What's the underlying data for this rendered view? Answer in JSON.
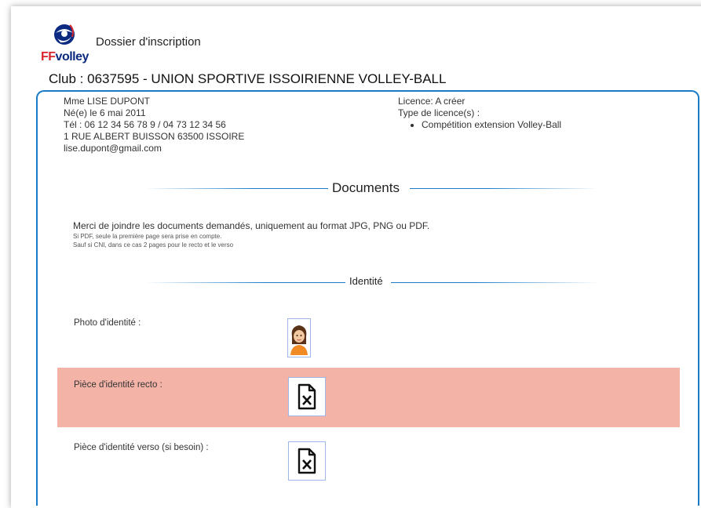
{
  "header": {
    "logo_text_ff": "FF",
    "logo_text_volley": "volley",
    "title": "Dossier d'inscription",
    "club": "Club : 0637595 - UNION SPORTIVE ISSOIRIENNE VOLLEY-BALL"
  },
  "person": {
    "name": "Mme LISE DUPONT",
    "birth": "Né(e) le 6 mai 2011",
    "phone": "Tél : 06 12 34 56 78 9 / 04 73 12 34 56",
    "address": "1 RUE ALBERT BUISSON 63500 ISSOIRE",
    "email": "lise.dupont@gmail.com"
  },
  "licence": {
    "status": "Licence: A créer",
    "types_label": "Type de licence(s) :",
    "types": [
      "Compétition extension Volley-Ball"
    ]
  },
  "documents": {
    "title": "Documents",
    "intro": "Merci de joindre les documents demandés, uniquement au format JPG, PNG ou PDF.",
    "note1": "Si PDF, seule la première page sera prise en compte.",
    "note2": "Sauf si CNI, dans ce cas 2 pages pour le recto et le verso"
  },
  "identite": {
    "title": "Identité",
    "rows": [
      {
        "label": "Photo d'identité :",
        "icon": "avatar-photo"
      },
      {
        "label": "Pièce d'identité recto :",
        "icon": "missing-document-icon"
      },
      {
        "label": "Pièce d'identité verso (si besoin) :",
        "icon": "missing-document-icon"
      }
    ]
  },
  "colors": {
    "accent": "#1a7cc9",
    "highlight": "#f3b3a7",
    "brand_red": "#d7262e",
    "brand_blue": "#0b2a80"
  }
}
